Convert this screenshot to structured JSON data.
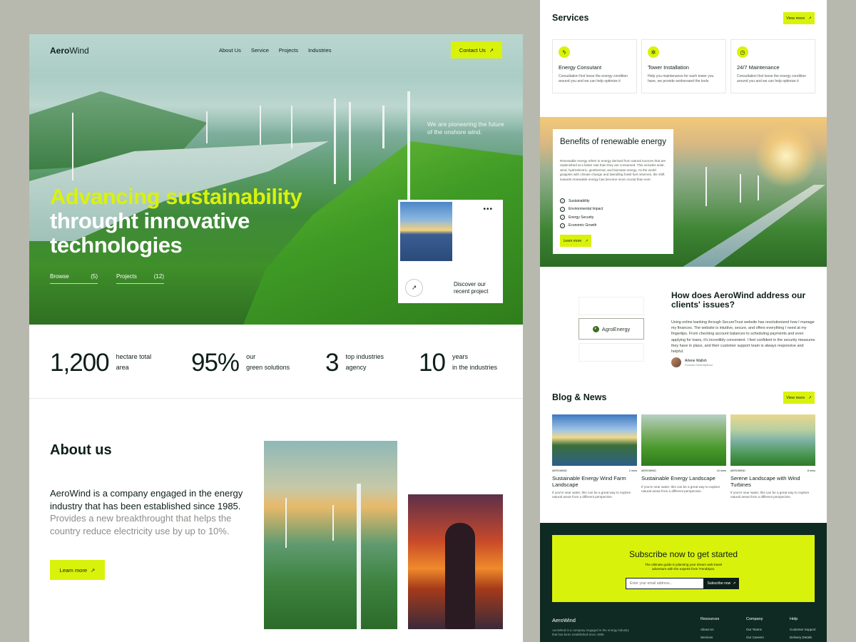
{
  "nav": {
    "logo_bold": "Aero",
    "logo_light": "Wind",
    "links": [
      "About Us",
      "Service",
      "Projects",
      "Industries"
    ],
    "contact": "Contact Us"
  },
  "hero": {
    "note": "We are pioneering the future of the onshore wind.",
    "title_highlight": "Advancing sustainability",
    "title_rest": "throught innovative technologies",
    "browse": {
      "label": "Browse",
      "count": "(5)"
    },
    "projects": {
      "label": "Projects",
      "count": "(12)"
    },
    "card_text": "Discover our recent project",
    "card_dots": "•••"
  },
  "stats": [
    {
      "num": "1,200",
      "label1": "hectare total",
      "label2": "area"
    },
    {
      "num": "95%",
      "label1": "our",
      "label2": "green solutions"
    },
    {
      "num": "3",
      "label1": "top industries",
      "label2": "agency"
    },
    {
      "num": "10",
      "label1": "years",
      "label2": "in the industries"
    }
  ],
  "about": {
    "title": "About us",
    "text_dark": "AeroWind is a company engaged in the energy industry that has been established since 1985.",
    "text_light": " Provides a new breakthrought that helps the country reduce electricity use by up to 10%.",
    "learn": "Learn more"
  },
  "services": {
    "title": "Services",
    "view": "View more",
    "items": [
      {
        "title": "Energy Consutant",
        "desc": "Consultation first loose the energy condition around you and we can help optimize it",
        "icon": "bolt-icon"
      },
      {
        "title": "Tower Installation",
        "desc": "Help you maintenance for each tower you have, we provide workersand the tools",
        "icon": "gear-icon"
      },
      {
        "title": "24/7 Maintenance",
        "desc": "Consultation first loose the energy condition around you and we can help optimize it",
        "icon": "clock-icon"
      }
    ]
  },
  "benefits": {
    "title": "Benefits of renewable energy",
    "desc": "Renewable energy refers to energy derived from natural sources that are replenished at a faster rate than they are consumed. This includes solar, wind, hydroelectric, geothermal, and biomass energy. As the world grapples with climate change and dwindling fossil fuel reserves, the shift towards renewable energy has become more crucial than ever.",
    "items": [
      "Sustainability",
      "Environmental Impact",
      "Energy Security",
      "Economic Growth"
    ],
    "learn": "Learn more"
  },
  "clients": {
    "logo": "AgroEnergy",
    "title": "How does AeroWind address our clients' issues?",
    "text": "Using online banking through SecureTrust website has revolutionized how I manage my finances. The website is intuitive, secure, and offers everything I need at my fingertips. From checking account balances to scheduling payments and even applying for loans, it's incredibly convenient. I feel confident in the security measures they have in place, and their customer support team is always responsive and helpful.",
    "author": "Arlene Wallsh",
    "role": "Founder SerenitySoul"
  },
  "blog": {
    "title": "Blog & News",
    "view": "View more",
    "posts": [
      {
        "tag": "AEROWIND",
        "time": "2 mins",
        "title": "Sustainable Energy Wind Farm Landscape",
        "desc": "If you're near water, this can be a great way to explore natural areas from a different perspective."
      },
      {
        "tag": "AEROWIND",
        "time": "10 mins",
        "title": "Sustainable Energy Landscape",
        "desc": "If you're near water, this can be a great way to explore natural areas from a different perspective."
      },
      {
        "tag": "AEROWIND",
        "time": "8 mins",
        "title": "Serene Landscape with Wind Turbines",
        "desc": "If you're near water, this can be a great way to explore natural areas from a different perspective."
      }
    ]
  },
  "subscribe": {
    "title": "Subscribe now to get started",
    "desc": "The ultimate guide to planning your dream web travel adventure with the experts from TrendSpot.",
    "placeholder": "Enter your email address...",
    "button": "Subscribe now"
  },
  "footer": {
    "logo": "AeroWind",
    "desc": "AeroWind is a company engaged in the energy industry that has been established since 1985.",
    "cols": [
      {
        "h": "Resources",
        "links": [
          "About Us",
          "Services"
        ]
      },
      {
        "h": "Company",
        "links": [
          "Our Teams",
          "Our Careers"
        ]
      },
      {
        "h": "Help",
        "links": [
          "Customer Support",
          "Delivery Details"
        ]
      }
    ]
  },
  "colors": {
    "accent": "#d9f20b",
    "dark": "#0f2a22",
    "text": "#0e1f1a"
  }
}
